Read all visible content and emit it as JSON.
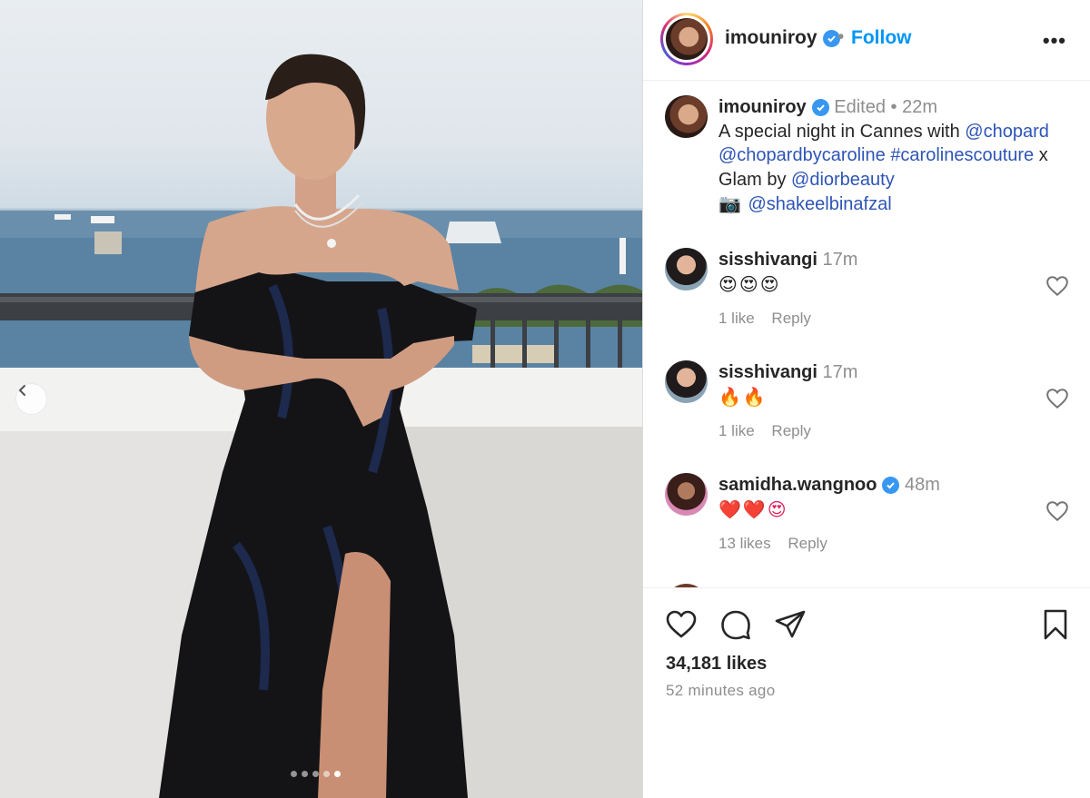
{
  "post": {
    "username": "imouniroy",
    "follow_label": "Follow",
    "separator": "•",
    "more_label": "•••",
    "photo_alt": "Woman in black off-shoulder gown on a balcony overlooking the sea in Cannes",
    "carousel_count": 5,
    "carousel_active_index": 4
  },
  "caption": {
    "username": "imouniroy",
    "edited": "Edited",
    "dot": "•",
    "time": "22m",
    "text_1": "A special night in Cannes with ",
    "mention_1": "@chopard",
    "mention_2": "@chopardbycaroline",
    "hashtag_1": "#carolinescouture",
    "text_2": " x",
    "text_3": "Glam by ",
    "mention_3": "@diorbeauty",
    "camera_emoji": "📷",
    "mention_4": "@shakeelbinafzal"
  },
  "comments": [
    {
      "username": "sisshivangi",
      "time": "17m",
      "text": "😍😍😍",
      "likes": "1 like",
      "reply": "Reply",
      "verified": false
    },
    {
      "username": "sisshivangi",
      "time": "17m",
      "text": "🔥🔥",
      "likes": "1 like",
      "reply": "Reply",
      "verified": false
    },
    {
      "username": "samidha.wangnoo",
      "time": "48m",
      "text": "❤️❤️😍",
      "likes": "13 likes",
      "reply": "Reply",
      "verified": true
    }
  ],
  "footer": {
    "likes": "34,181 likes",
    "posted": "52 minutes ago"
  },
  "colors": {
    "link": "#2e55b6",
    "follow": "#0095f6",
    "verified": "#3897f0",
    "muted": "#8e8e8e"
  }
}
